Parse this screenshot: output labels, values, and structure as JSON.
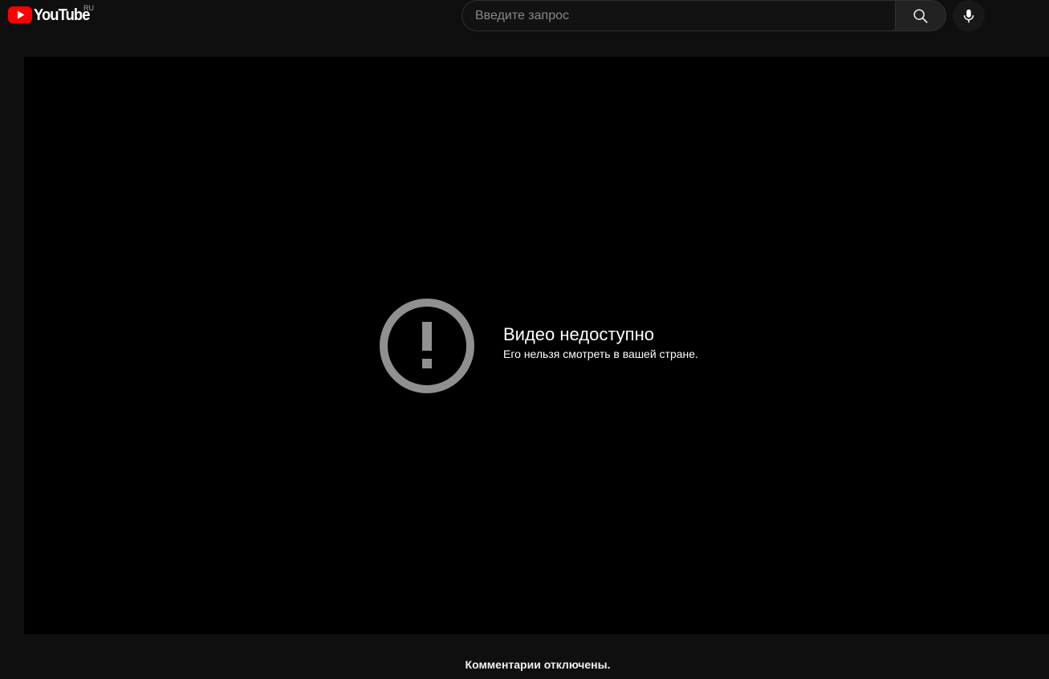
{
  "header": {
    "logo_text": "YouTube",
    "country_code": "RU",
    "logo_icon": "youtube-play-icon",
    "brand_color": "#ff0000"
  },
  "search": {
    "placeholder": "Введите запрос",
    "value": "",
    "search_icon": "search-icon",
    "voice_icon": "microphone-icon"
  },
  "player": {
    "error_icon": "exclamation-circle-icon",
    "error_title": "Видео недоступно",
    "error_subtitle": "Его нельзя смотреть в вашей стране."
  },
  "comments": {
    "status_text": "Комментарии отключены."
  }
}
